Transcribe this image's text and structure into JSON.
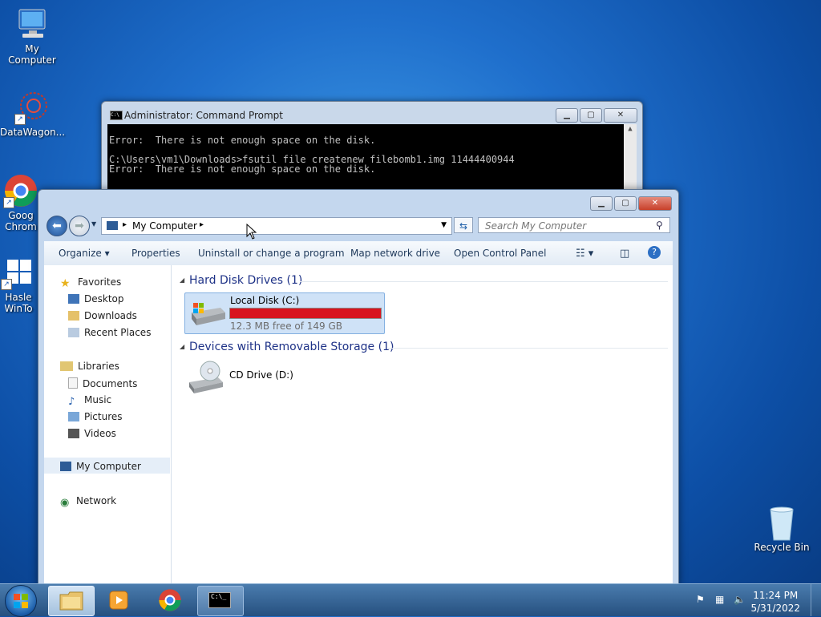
{
  "desktop": {
    "icons": [
      {
        "label": "My Computer"
      },
      {
        "label": "DataWagon..."
      },
      {
        "label": "Goog\nChrom"
      },
      {
        "label": "Hasle\nWinTo"
      },
      {
        "label": "Recycle Bin"
      }
    ]
  },
  "cmd": {
    "title": "Administrator: Command Prompt",
    "lines": [
      "Error:  There is not enough space on the disk.",
      "",
      "C:\\Users\\vm1\\Downloads>fsutil file createnew filebomb1.img 11444400944",
      "Error:  There is not enough space on the disk."
    ]
  },
  "explorer": {
    "address_crumb": "My Computer",
    "search_placeholder": "Search My Computer",
    "toolbar": {
      "organize": "Organize",
      "properties": "Properties",
      "uninstall": "Uninstall or change a program",
      "map_drive": "Map network drive",
      "control_panel": "Open Control Panel"
    },
    "nav": {
      "favorites": "Favorites",
      "desktop": "Desktop",
      "downloads": "Downloads",
      "recent": "Recent Places",
      "libraries": "Libraries",
      "documents": "Documents",
      "music": "Music",
      "pictures": "Pictures",
      "videos": "Videos",
      "computer": "My Computer",
      "network": "Network"
    },
    "groups": {
      "hdd": "Hard Disk Drives (1)",
      "removable": "Devices with Removable Storage (1)"
    },
    "drives": {
      "c_name": "Local Disk (C:)",
      "c_free": "12.3 MB free of 149 GB",
      "c_used_fraction": 0.9999,
      "d_name": "CD Drive (D:)"
    }
  },
  "taskbar": {
    "time": "11:24 PM",
    "date": "5/31/2022"
  },
  "colors": {
    "disk_full_bar": "#d8141f"
  }
}
